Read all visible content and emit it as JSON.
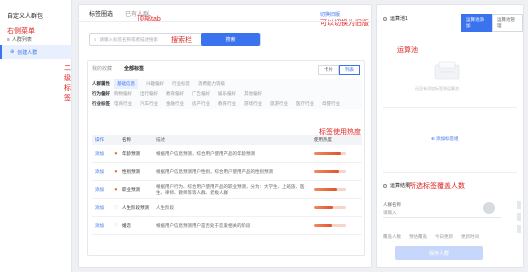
{
  "sidebar": {
    "brand": "自定义人群包",
    "annotation": "右侧菜单",
    "list_label": "人群列表",
    "create_label": "创建人群"
  },
  "vertical_annotation": "二级标签",
  "main": {
    "tabs": [
      {
        "label": "标签圈选",
        "active": true
      },
      {
        "label": "已有人群",
        "active": false
      }
    ],
    "top_annotation": "顶部tab",
    "switch_link": "切换旧版",
    "switch_annotation": "可以切换为旧版",
    "search": {
      "placeholder": "请输入标签名称或者描述搜索",
      "button": "搜索",
      "annotation": "搜索栏"
    },
    "panel": {
      "tabs": [
        {
          "label": "我的收藏",
          "active": false
        },
        {
          "label": "全部标签",
          "active": true
        }
      ],
      "view_toggle": [
        "卡片",
        "列表"
      ],
      "filters": [
        {
          "key": "人群属性",
          "options": [
            "基础信息",
            "兴趣偏好",
            "行业标签",
            "消费能力等级"
          ],
          "selected": 0
        },
        {
          "key": "行为偏好",
          "options": [
            "购物偏好",
            "出行偏好",
            "教育偏好",
            "广告偏好",
            "娱乐偏好",
            "其他偏好"
          ],
          "selected": -1
        },
        {
          "key": "行业标签",
          "options": [
            "电商行业",
            "汽车行业",
            "金融行业",
            "房产行业",
            "教育行业",
            "游戏行业",
            "旅游行业",
            "医疗行业",
            "母婴行业"
          ],
          "selected": -1
        }
      ],
      "table": {
        "headers": [
          "操作",
          "",
          "名称",
          "描述",
          "使用热度"
        ],
        "rows": [
          {
            "op": "添加",
            "fav": true,
            "name": "年龄预测",
            "desc": "根据用户信息预测，综合用户使用产品的年龄预测",
            "heat": 0.85
          },
          {
            "op": "添加",
            "fav": true,
            "name": "性别预测",
            "desc": "根据用户信息预测用户性别，综合用户使用产品的性别预测",
            "heat": 0.78
          },
          {
            "op": "添加",
            "fav": true,
            "name": "职业预测",
            "desc": "根据用户行为、综合用户使用产品的职业预测，分为：大学生、上班族、医生、律师、教师等等人群、老板人群",
            "heat": 0.72
          },
          {
            "op": "添加",
            "fav": false,
            "name": "人生阶段预测",
            "desc": "人生阶段",
            "heat": 0.6
          },
          {
            "op": "添加",
            "fav": false,
            "name": "婚恋",
            "desc": "根据用户信息预测用户是否处于恋爱相关的阶段",
            "heat": 0.55
          }
        ]
      },
      "heat_annotation": "标签使用热度"
    }
  },
  "right": {
    "pool_title": "运算池1",
    "tabs": [
      {
        "label": "运算池添加",
        "active": true
      },
      {
        "label": "运算池管理",
        "active": false
      }
    ],
    "pool_annotation": "运算池",
    "empty_text": "还没有添加标签到运算池",
    "add_link": "添加标签组",
    "result_title": "运算结果",
    "result_annotation": "所选标签覆盖人数",
    "crowd_label": "人群名称",
    "crowd_placeholder": "请输入",
    "stats": [
      "覆盖人数",
      "预估覆盖",
      "今日更新",
      "更新时间"
    ],
    "save_button": "保存人群"
  }
}
